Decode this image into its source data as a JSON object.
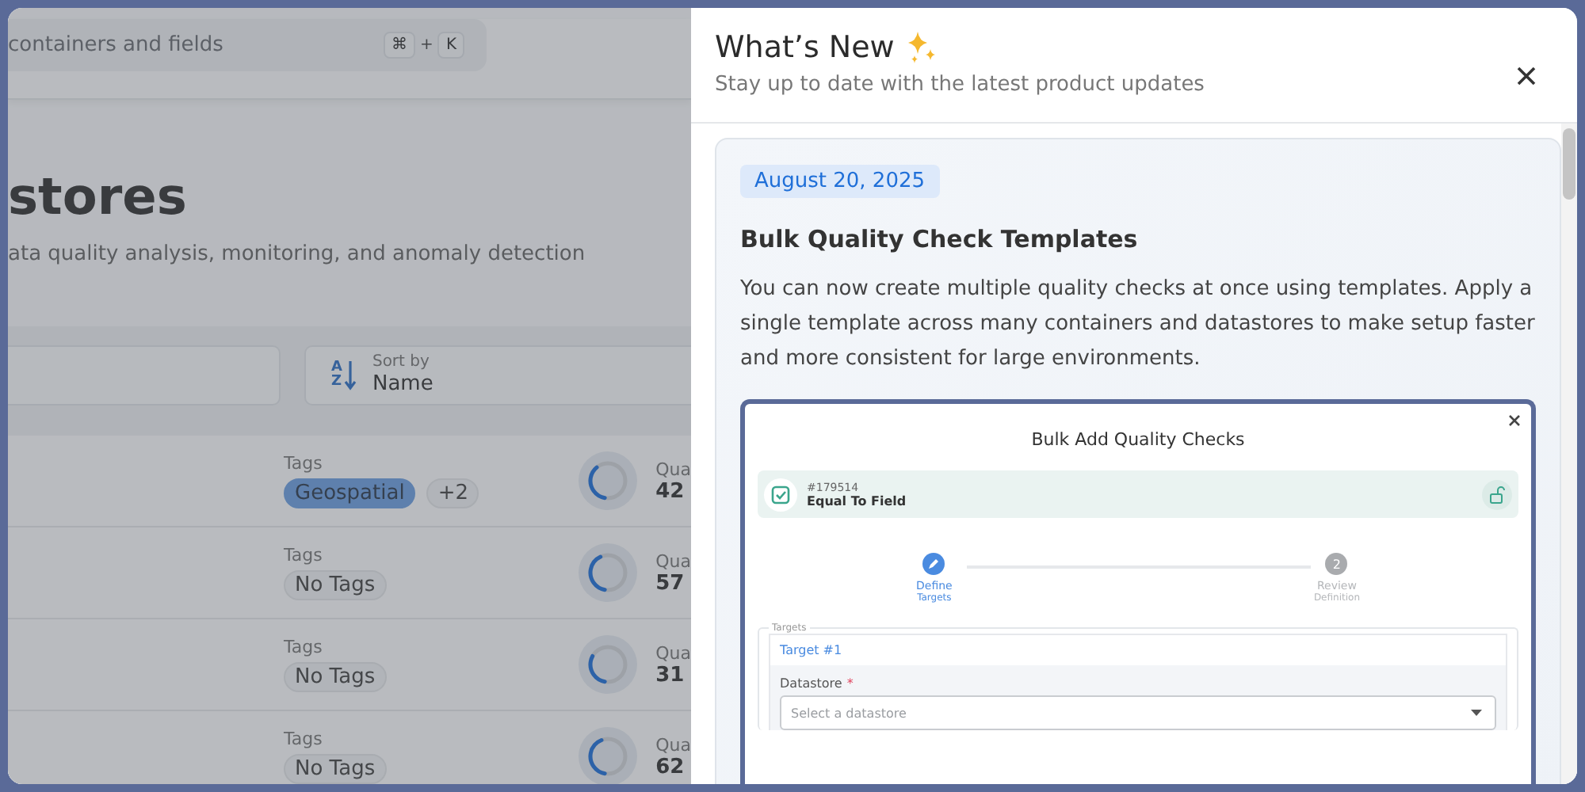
{
  "search": {
    "placeholder": "containers and fields",
    "shortcut": [
      {
        "kind": "key",
        "text": "⌘"
      },
      {
        "kind": "joiner",
        "text": "+"
      },
      {
        "kind": "key",
        "text": "K"
      }
    ]
  },
  "page": {
    "title": "stores",
    "subtitle": "ata quality analysis, monitoring, and anomaly detection"
  },
  "sort": {
    "icon_letters": [
      "A",
      "Z"
    ],
    "label": "Sort by",
    "value": "Name"
  },
  "rows": [
    {
      "tags_label": "Tags",
      "tags": [
        {
          "kind": "tag",
          "text": "Geospatial"
        },
        {
          "kind": "more",
          "text": "+2"
        }
      ],
      "level": 0.36,
      "metric_label": "Qua",
      "metric_value": "42"
    },
    {
      "tags_label": "Tags",
      "tags": [
        {
          "kind": "empty",
          "text": "No Tags"
        }
      ],
      "level": 0.4,
      "metric_label": "Qua",
      "metric_value": "57"
    },
    {
      "tags_label": "Tags",
      "tags": [
        {
          "kind": "empty",
          "text": "No Tags"
        }
      ],
      "level": 0.3,
      "metric_label": "Qua",
      "metric_value": "31"
    },
    {
      "tags_label": "Tags",
      "tags": [
        {
          "kind": "empty",
          "text": "No Tags"
        }
      ],
      "level": 0.41,
      "metric_label": "Qua",
      "metric_value": "62"
    }
  ],
  "drawer": {
    "title": "What’s New",
    "subtitle": "Stay up to date with the latest product updates",
    "entries": [
      {
        "date": "August 20, 2025",
        "title": "Bulk Quality Check Templates",
        "body": "You can now create multiple quality checks at once using templates. Apply a single template across many containers and datastores to make setup faster and more consistent for large environments.",
        "screenshot": {
          "title": "Bulk Add Quality Checks",
          "check": {
            "id": "#179514",
            "name": "Equal To Field"
          },
          "steps": [
            {
              "title": "Define",
              "subtitle": "Targets",
              "selected": true
            },
            {
              "number": "2",
              "title": "Review",
              "subtitle": "Definition",
              "selected": false
            }
          ],
          "legend": "Targets",
          "target": "Target #1",
          "field": {
            "label": "Datastore",
            "required_mark": "*",
            "placeholder": "Select a datastore"
          }
        }
      }
    ]
  }
}
